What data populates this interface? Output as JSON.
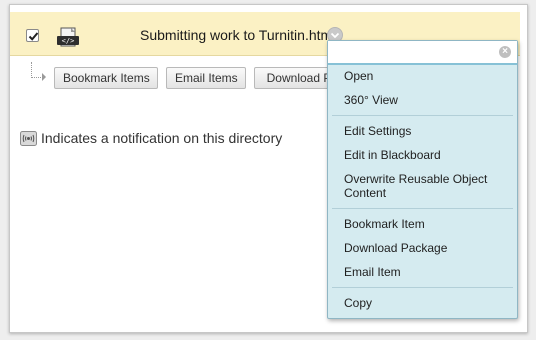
{
  "item": {
    "title": "Submitting work to Turnitin.html",
    "checked": true,
    "file_icon": "html-file-icon"
  },
  "actions": {
    "bookmark_label": "Bookmark Items",
    "email_label": "Email Items",
    "download_label": "Download P"
  },
  "note": {
    "text": "Indicates a notification on this directory",
    "icon": "notification-icon"
  },
  "menu": {
    "filter_placeholder": "",
    "clear_icon": "×",
    "items": [
      {
        "label": "Open"
      },
      {
        "label": "360° View"
      },
      {
        "label": "Edit Settings"
      },
      {
        "label": "Edit in Blackboard"
      },
      {
        "label": "Overwrite Reusable Object Content"
      },
      {
        "label": "Bookmark Item"
      },
      {
        "label": "Download Package"
      },
      {
        "label": "Email Item"
      },
      {
        "label": "Copy"
      }
    ]
  },
  "colors": {
    "row_highlight": "#fbf1c4",
    "menu_bg": "#d5ebf0",
    "menu_border": "#8fb6c4"
  }
}
